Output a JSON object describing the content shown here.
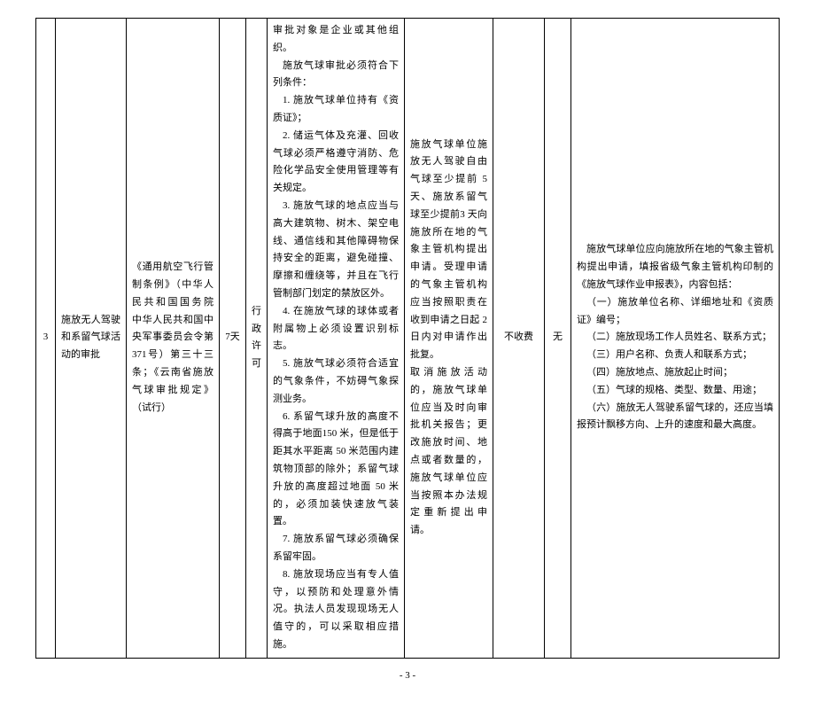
{
  "page_number": "- 3 -",
  "row": {
    "num": "3",
    "name": "施放无人驾驶和系留气球活动的审批",
    "basis": "《通用航空飞行管制条例》（中华人民共和国国务院　中华人民共和国中央军事委员会令第 371号）第三十三条；《云南省施放气球审批规定》（试行）",
    "time_limit": "7天",
    "type": "行政许可",
    "conditions": {
      "intro": "审批对象是企业或其他组织。",
      "intro2": "施放气球审批必须符合下列条件：",
      "c1": "1. 施放气球单位持有《资质证》；",
      "c2": "2. 储运气体及充灌、回收气球必须严格遵守消防、危险化学品安全使用管理等有关规定。",
      "c3": "3. 施放气球的地点应当与高大建筑物、树木、架空电线、通信线和其他障碍物保持安全的距离，避免碰撞、摩擦和缠绕等，并且在飞行管制部门划定的禁放区外。",
      "c4": "4. 在施放气球的球体或者附属物上必须设置识别标志。",
      "c5": "5. 施放气球必须符合适宜的气象条件，不妨碍气象探测业务。",
      "c6": "6. 系留气球升放的高度不得高于地面150 米，但是低于距其水平距离 50 米范围内建筑物顶部的除外；系留气球升放的高度超过地面 50 米的，必须加装快速放气装置。",
      "c7": "7. 施放系留气球必须确保系留牢固。",
      "c8": "8. 施放现场应当有专人值守，以预防和处理意外情况。执法人员发现现场无人值守的，可以采取相应措施。"
    },
    "procedure": {
      "p1": "施放气球单位施放无人驾驶自由气球至少提前 5 天、施放系留气球至少提前3 天向施放所在地的气象主管机构提出申请。受理申请的气象主管机构应当按照职责在收到申请之日起 2 日内对申请作出批复。",
      "p2": "取消施放活动的，施放气球单位应当及时向审批机关报告；更改施放时间、地点或者数量的，施放气球单位应当按照本办法规定重新提出申请。"
    },
    "fee": "不收费",
    "fee_basis": "无",
    "notes": {
      "n0": "施放气球单位应向施放所在地的气象主管机构提出申请，填报省级气象主管机构印制的《施放气球作业申报表》，内容包括：",
      "n1": "（一）施放单位名称、详细地址和《资质证》编号；",
      "n2": "（二）施放现场工作人员姓名、联系方式；",
      "n3": "（三）用户名称、负责人和联系方式；",
      "n4": "（四）施放地点、施放起止时间；",
      "n5": "（五）气球的规格、类型、数量、用途；",
      "n6": "（六）施放无人驾驶系留气球的，还应当填报预计飘移方向、上升的速度和最大高度。"
    }
  }
}
